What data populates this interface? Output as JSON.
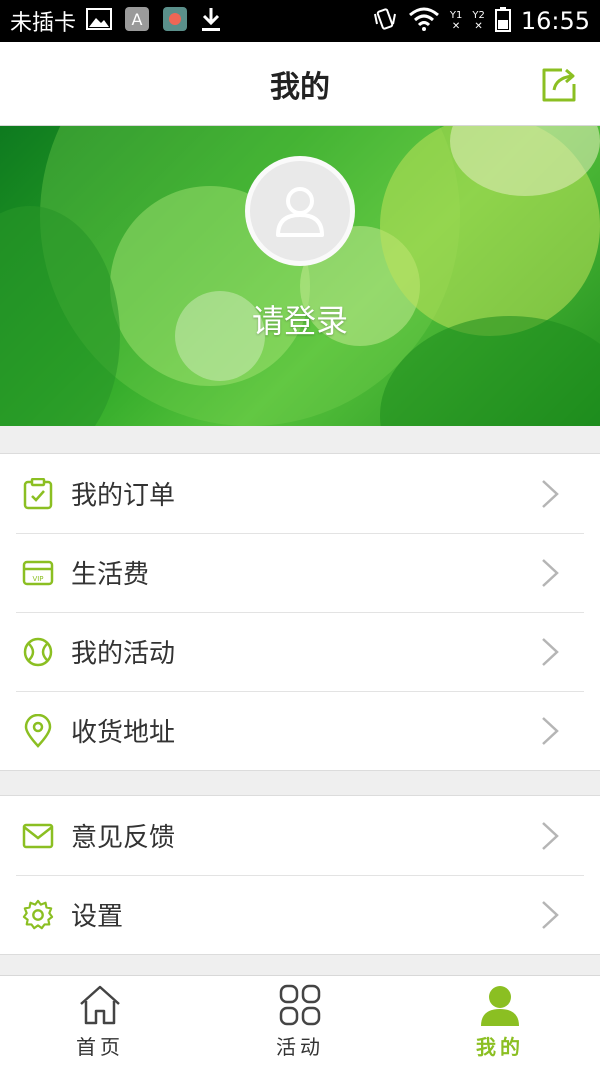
{
  "status_bar": {
    "carrier": "未插卡",
    "sim1": "Y1",
    "sim2": "Y2",
    "time": "16:55"
  },
  "header": {
    "title": "我的"
  },
  "profile": {
    "login_prompt": "请登录"
  },
  "menu_group_1": [
    {
      "label": "我的订单",
      "icon": "order-clipboard-icon"
    },
    {
      "label": "生活费",
      "icon": "vip-card-icon"
    },
    {
      "label": "我的活动",
      "icon": "ball-icon"
    },
    {
      "label": "收货地址",
      "icon": "location-pin-icon"
    }
  ],
  "menu_group_2": [
    {
      "label": "意见反馈",
      "icon": "mail-icon"
    },
    {
      "label": "设置",
      "icon": "gear-icon"
    }
  ],
  "bottom_nav": [
    {
      "label": "首页",
      "icon": "home-icon",
      "active": false
    },
    {
      "label": "活动",
      "icon": "grid-icon",
      "active": false
    },
    {
      "label": "我的",
      "icon": "person-icon",
      "active": true
    }
  ],
  "colors": {
    "accent": "#8bbf22",
    "banner_green": "#2aa526",
    "status_bar_bg": "#000000"
  }
}
